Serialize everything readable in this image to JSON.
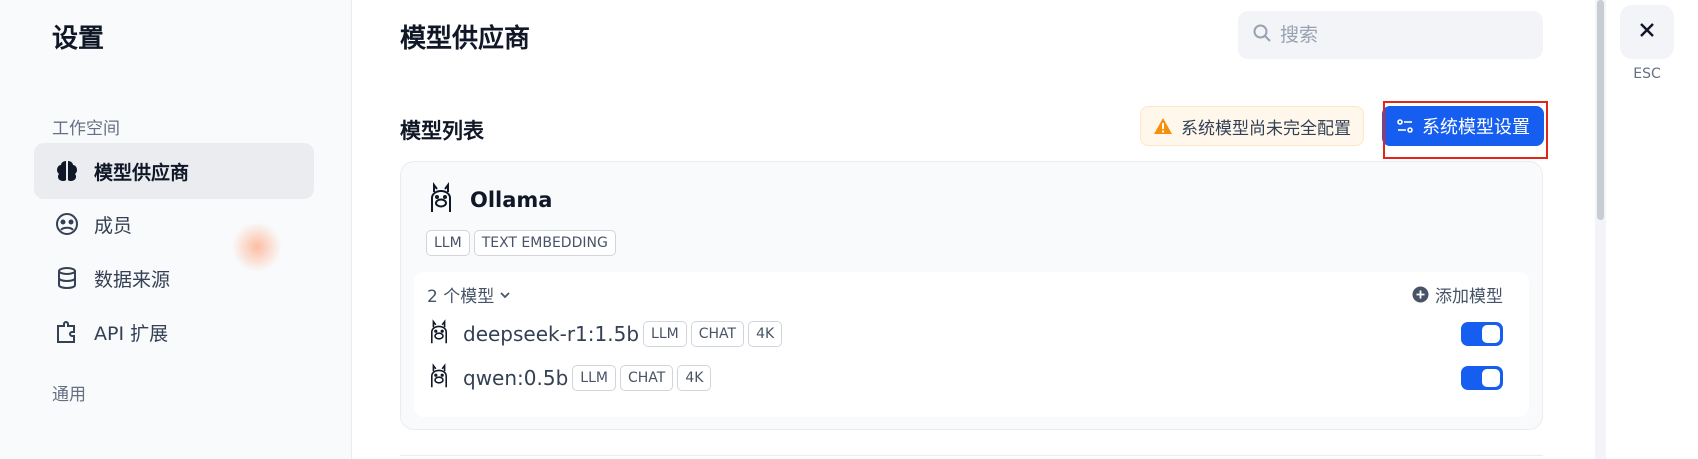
{
  "sidebar": {
    "title": "设置",
    "sections": [
      {
        "label": "工作空间",
        "items": [
          {
            "label": "模型供应商",
            "icon": "brain-icon",
            "active": true
          },
          {
            "label": "成员",
            "icon": "members-icon",
            "active": false
          },
          {
            "label": "数据来源",
            "icon": "database-icon",
            "active": false
          },
          {
            "label": "API 扩展",
            "icon": "puzzle-icon",
            "active": false
          }
        ]
      },
      {
        "label": "通用"
      }
    ]
  },
  "main": {
    "title": "模型供应商",
    "search": {
      "placeholder": "搜索",
      "value": ""
    },
    "list_title": "模型列表",
    "warning_text": "系统模型尚未完全配置",
    "system_settings_label": "系统模型设置",
    "provider": {
      "name": "Ollama",
      "icon": "llama-icon",
      "tags": [
        "LLM",
        "TEXT EMBEDDING"
      ],
      "model_count_label": "2 个模型",
      "add_model_label": "添加模型",
      "models": [
        {
          "name": "deepseek-r1:1.5b",
          "tags": [
            "LLM",
            "CHAT",
            "4K"
          ],
          "enabled": true
        },
        {
          "name": "qwen:0.5b",
          "tags": [
            "LLM",
            "CHAT",
            "4K"
          ],
          "enabled": true
        }
      ]
    }
  },
  "close": {
    "esc_label": "ESC"
  },
  "colors": {
    "accent": "#155eef",
    "warning": "#f79009",
    "highlight": "#e3261c"
  }
}
